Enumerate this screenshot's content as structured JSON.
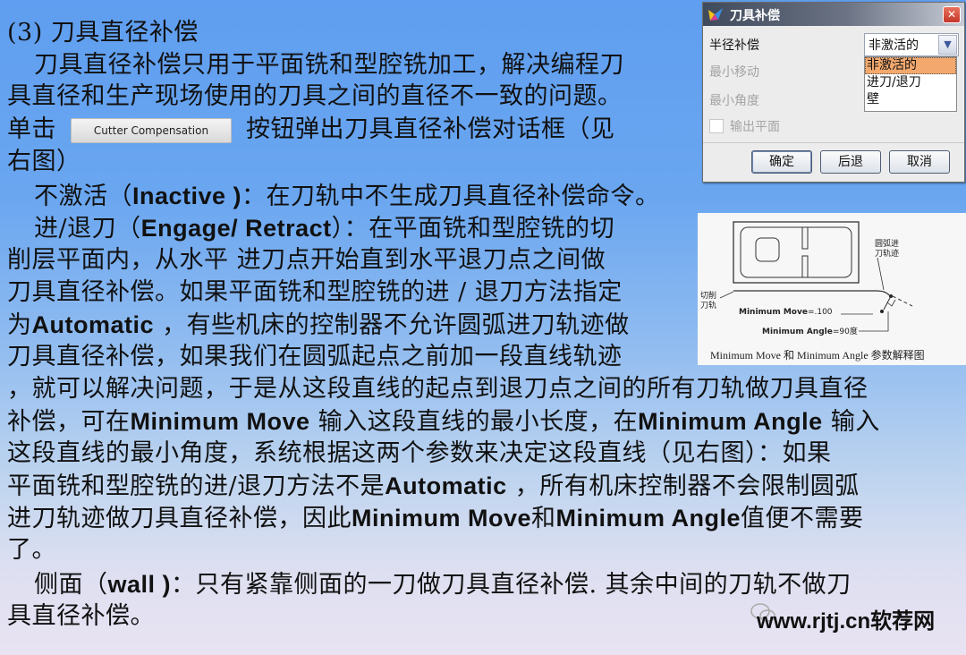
{
  "section": {
    "number": "(3)",
    "title": "刀具直径补偿"
  },
  "paragraphs": {
    "intro_l1": "刀具直径补偿只用于平面铣和型腔铣加工，解决编程刀",
    "intro_l2": "具直径和生产现场使用的刀具之间的直径不一致的问题。",
    "intro_l3_pre": "单击",
    "intro_l3_post": "按钮弹出刀具直径补偿对话框（见",
    "intro_l4": "右图）",
    "inactive_pre": "不激活（",
    "inactive_term": "Inactive )",
    "inactive_post": "：在刀轨中不生成刀具直径补偿命令。",
    "engage_pre": "进/退刀（",
    "engage_term": "Engage/ Retract",
    "engage_post": "）：在平面铣和型腔铣的切",
    "engage_l2": "削层平面内，从水平 进刀点开始直到水平退刀点之间做",
    "engage_l3": "刀具直径补偿。如果平面铣和型腔铣的进 / 退刀方法指定",
    "engage_l4_pre": "为",
    "engage_l4_term": "Automatic",
    "engage_l4_post": " ，有些机床的控制器不允许圆弧进刀轨迹做",
    "engage_l5": "刀具直径补偿，如果我们在圆弧起点之前加一段直线轨迹",
    "engage_l6": "，就可以解决问题，于是从这段直线的起点到退刀点之间的所有刀轨做刀具直径",
    "engage_l7_a": "补偿，可在",
    "engage_l7_b": "Minimum Move",
    "engage_l7_c": " 输入这段直线的最小长度，在",
    "engage_l7_d": "Minimum Angle",
    "engage_l7_e": " 输入",
    "engage_l8": "这段直线的最小角度，系统根据这两个参数来决定这段直线（见右图）：如果",
    "engage_l9_a": "平面铣和型腔铣的进/退刀方法不是",
    "engage_l9_b": "Automatic",
    "engage_l9_c": " ，所有机床控制器不会限制圆弧",
    "engage_l10_a": "进刀轨迹做刀具直径补偿，因此",
    "engage_l10_b": "Minimum Move",
    "engage_l10_c": "和",
    "engage_l10_d": "Minimum Angle",
    "engage_l10_e": "值便不需要",
    "engage_l11": "了。",
    "wall_pre": "侧面（",
    "wall_term": "wall )",
    "wall_post": "：只有紧靠侧面的一刀做刀具直径补偿. 其余中间的刀轨不做刀",
    "wall_l2": "具直径补偿。"
  },
  "inline_button": {
    "label": "Cutter Compensation"
  },
  "dialog": {
    "title": "刀具补偿",
    "icon": "nx-logo-icon",
    "radius_comp_label": "半径补偿",
    "selected": "非激活的",
    "options": [
      "非激活的",
      "进刀/退刀",
      "壁"
    ],
    "highlighted_option": "非激活的",
    "min_move_label": "最小移动",
    "min_angle_label": "最小角度",
    "output_plane_label": "输出平面",
    "output_plane_checked": false,
    "buttons": {
      "ok": "确定",
      "back": "后退",
      "cancel": "取消"
    },
    "colors": {
      "highlight": "#f3a96e",
      "close": "#c4362a"
    }
  },
  "figure": {
    "label_cut_path": "切削\n刀轨",
    "label_cut_path_l1": "切削",
    "label_cut_path_l2": "刀轨",
    "label_arc_l1": "圆弧进",
    "label_arc_l2": "刀轨迹",
    "min_move_text": "Minimum Move",
    "min_move_value": "=.100",
    "min_angle_text": "Minimum Angle",
    "min_angle_value": "=90度",
    "caption": "Minimum  Move 和 Minimum  Angle 参数解释图"
  },
  "watermark": {
    "text": "www.rjtj.cn软荐网"
  }
}
